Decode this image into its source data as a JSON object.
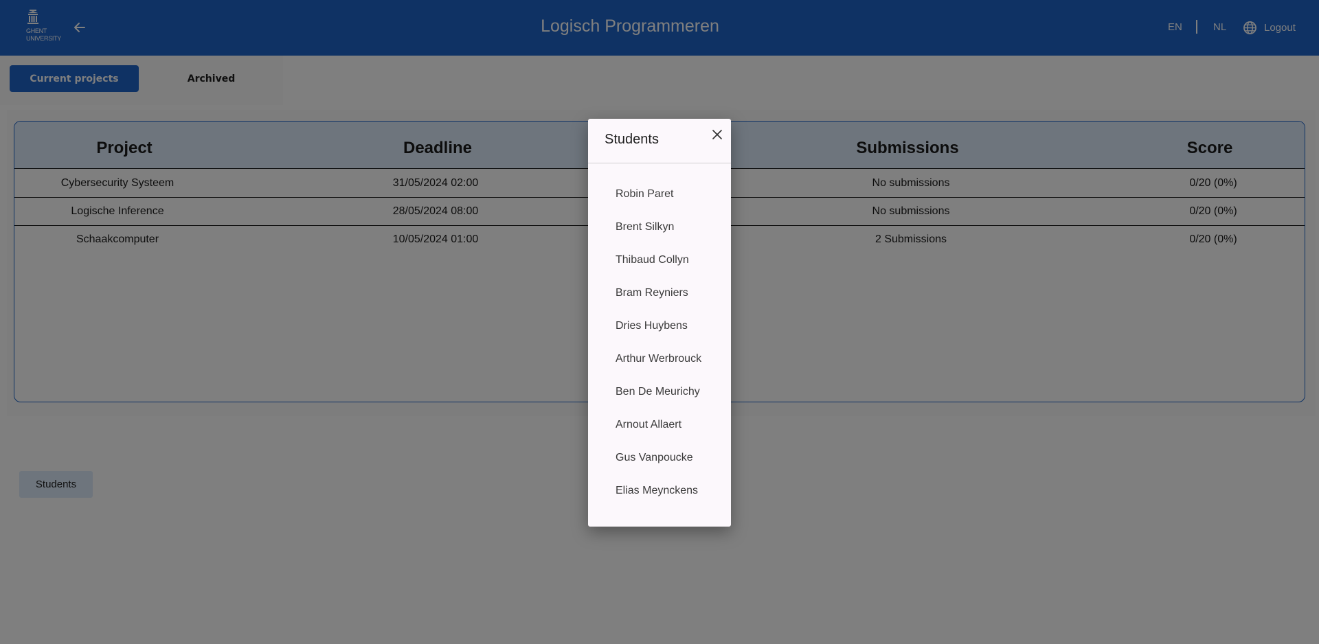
{
  "header": {
    "logo_line1": "GHENT",
    "logo_line2": "UNIVERSITY",
    "title": "Logisch Programmeren",
    "lang_en": "EN",
    "lang_nl": "NL",
    "logout": "Logout",
    "brand_color": "#1E64C8"
  },
  "tabs": {
    "current": "Current projects",
    "archived": "Archived"
  },
  "table": {
    "headers": [
      "Project",
      "Deadline",
      "",
      "Submissions",
      "Score"
    ],
    "rows": [
      {
        "project": "Cybersecurity Systeem",
        "deadline": "31/05/2024 02:00",
        "submissions": "No submissions",
        "score": "0/20 (0%)"
      },
      {
        "project": "Logische Inference",
        "deadline": "28/05/2024 08:00",
        "submissions": "No submissions",
        "score": "0/20 (0%)"
      },
      {
        "project": "Schaakcomputer",
        "deadline": "10/05/2024 01:00",
        "submissions": "2 Submissions",
        "score": "0/20 (0%)"
      }
    ]
  },
  "students_button": "Students",
  "dialog": {
    "title": "Students",
    "students": [
      "Robin Paret",
      "Brent Silkyn",
      "Thibaud Collyn",
      "Bram Reyniers",
      "Dries Huybens",
      "Arthur Werbrouck",
      "Ben De Meurichy",
      "Arnout Allaert",
      "Gus Vanpoucke",
      "Elias Meynckens"
    ]
  },
  "icons": {
    "back": "arrow-left-icon",
    "globe": "globe-icon",
    "close": "close-icon",
    "logo": "university-building-icon"
  }
}
